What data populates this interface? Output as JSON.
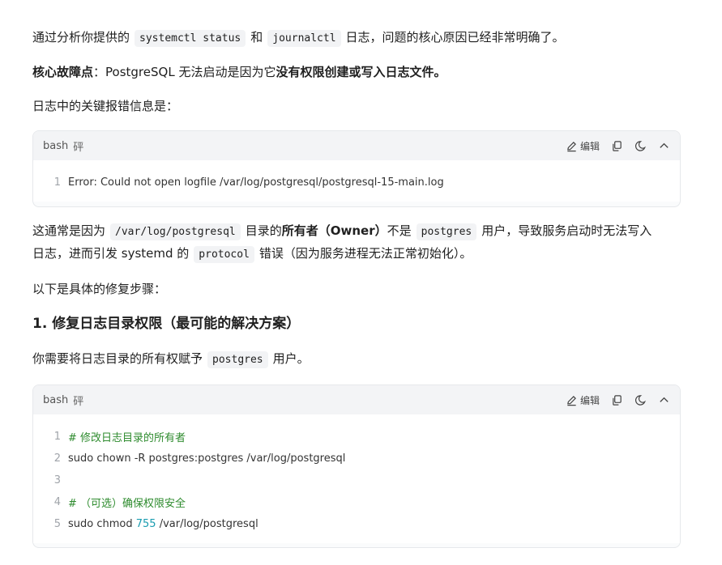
{
  "intro": {
    "before": "通过分析你提供的",
    "code1": "systemctl status",
    "mid": "和",
    "code2": "journalctl",
    "after": "日志，问题的核心原因已经非常明确了。"
  },
  "core_fault": {
    "label": "核心故障点",
    "colon": "：PostgreSQL 无法启动是因为它",
    "bold": "没有权限创建或写入日志文件",
    "end": "。"
  },
  "log_intro": "日志中的关键报错信息是：",
  "codeblock1": {
    "lang": "bash",
    "lang_extra": "砰",
    "edit_label": "编辑",
    "lines": [
      {
        "num": "1",
        "text": "Error: Could not open logfile /var/log/postgresql/postgresql-15-main.log"
      }
    ]
  },
  "explanation": {
    "p1": "这通常是因为",
    "code1": "/var/log/postgresql",
    "p2": "目录的",
    "bold": "所有者（Owner）",
    "p3": "不是",
    "code2": "postgres",
    "p4": "用户，导致服务启动时无法写入",
    "p5": "日志，进而引发 systemd 的",
    "code3": "protocol",
    "p6": "错误（因为服务进程无法正常初始化）。"
  },
  "steps_intro": "以下是具体的修复步骤：",
  "heading1": "1. 修复日志目录权限（最可能的解决方案）",
  "step1_text": {
    "before": "你需要将日志目录的所有权赋予",
    "code": "postgres",
    "after": "用户。"
  },
  "codeblock2": {
    "lang": "bash",
    "lang_extra": "砰",
    "edit_label": "编辑",
    "lines": [
      {
        "num": "1",
        "text": "# 修改日志目录的所有者"
      },
      {
        "num": "2",
        "text": "sudo chown -R postgres:postgres /var/log/postgresql"
      },
      {
        "num": "3",
        "text": ""
      },
      {
        "num": "4",
        "text": "# （可选）确保权限安全"
      },
      {
        "num": "5",
        "pre": "sudo chmod ",
        "numtok": "755",
        "post": " /var/log/postgresql"
      }
    ]
  },
  "colors": {
    "comment": "#2e8b2e",
    "number": "#1a9cb0"
  }
}
